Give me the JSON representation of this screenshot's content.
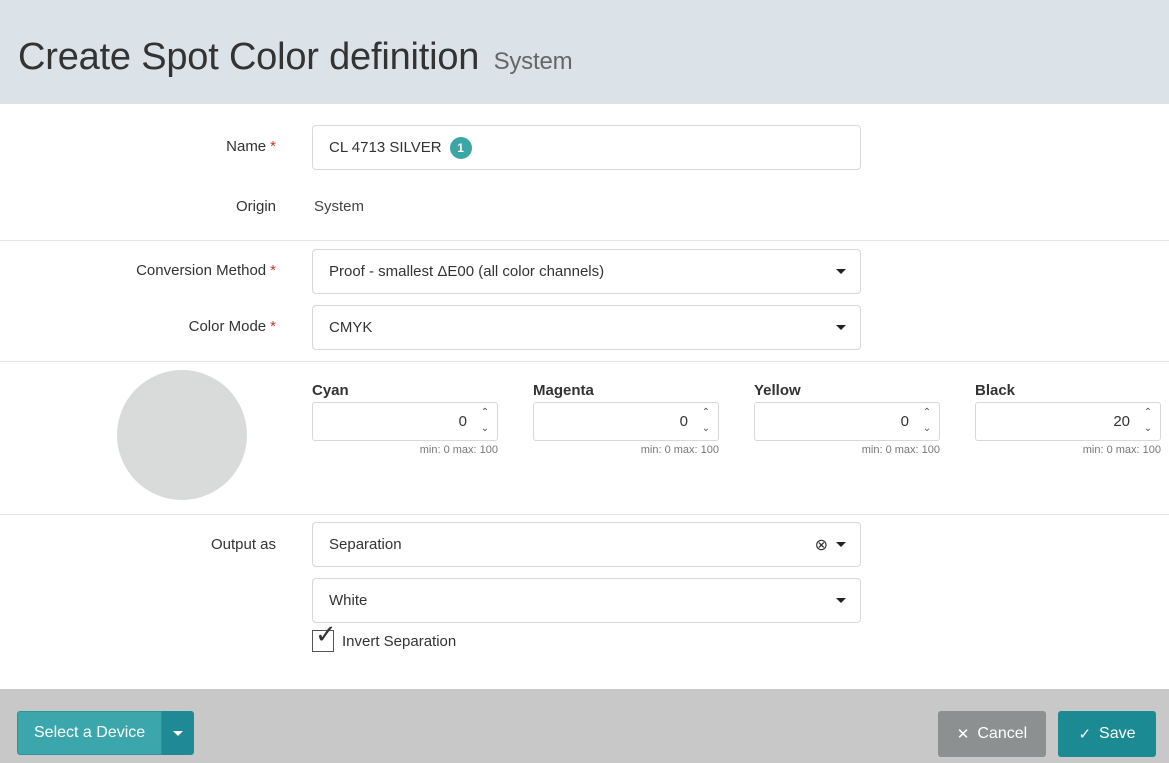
{
  "header": {
    "title": "Create Spot Color definition",
    "subtitle": "System"
  },
  "form": {
    "name": {
      "label": "Name",
      "required_mark": "*",
      "value": "CL 4713 SILVER",
      "badge": "1"
    },
    "origin": {
      "label": "Origin",
      "value": "System"
    },
    "conversion_method": {
      "label": "Conversion Method",
      "required_mark": "*",
      "value": "Proof - smallest ΔE00 (all color channels)"
    },
    "color_mode": {
      "label": "Color Mode",
      "required_mark": "*",
      "value": "CMYK"
    },
    "swatch_color": "#d9dada",
    "channels": [
      {
        "label": "Cyan",
        "value": "0",
        "range": "min: 0  max: 100"
      },
      {
        "label": "Magenta",
        "value": "0",
        "range": "min: 0  max: 100"
      },
      {
        "label": "Yellow",
        "value": "0",
        "range": "min: 0  max: 100"
      },
      {
        "label": "Black",
        "value": "20",
        "range": "min: 0  max: 100"
      }
    ],
    "output_as": {
      "label": "Output as",
      "value": "Separation",
      "separation_value": "White",
      "invert_label": "Invert Separation",
      "invert_checked": true
    }
  },
  "footer": {
    "select_device_label": "Select a Device",
    "cancel_label": "Cancel",
    "save_label": "Save"
  },
  "colors": {
    "header_bg": "#dbe2e8",
    "accent": "#1c8a92",
    "badge": "#3aa6a6",
    "required": "#c0392b",
    "footer_bg": "#c8c8c8",
    "cancel_bg": "#8c9090"
  },
  "icons": {
    "clear": "clear-circle-icon",
    "caret": "chevron-down-icon",
    "check": "check-icon",
    "close": "close-icon"
  }
}
